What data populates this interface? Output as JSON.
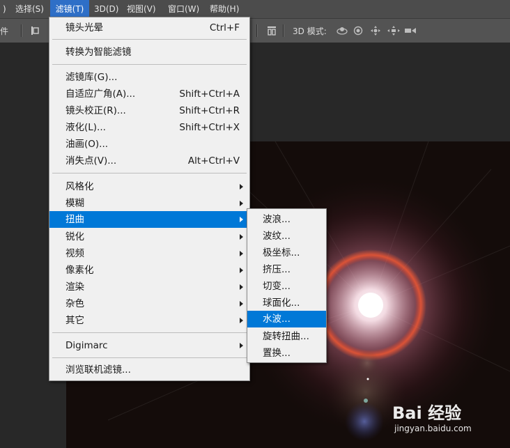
{
  "menubar": {
    "items": [
      {
        "label": ")"
      },
      {
        "label": "选择(S)"
      },
      {
        "label": "滤镜(T)"
      },
      {
        "label": "3D(D)"
      },
      {
        "label": "视图(V)"
      },
      {
        "label": "窗口(W)"
      },
      {
        "label": "帮助(H)"
      }
    ],
    "active_index": 2,
    "active_color": "#2e6fc7"
  },
  "options_bar": {
    "left_text": "件",
    "mode_label": "3D 模式:",
    "icons": [
      "align-icon",
      "distribute-icon",
      "orbit-3d-icon",
      "roll-3d-icon",
      "pan-3d-icon",
      "slide-3d-icon",
      "scale-3d-icon"
    ]
  },
  "filter_menu": {
    "items": [
      {
        "label": "镜头光晕",
        "shortcut": "Ctrl+F",
        "submenu": false
      },
      {
        "separator": true
      },
      {
        "label": "转换为智能滤镜",
        "shortcut": "",
        "submenu": false
      },
      {
        "separator": true
      },
      {
        "label": "滤镜库(G)...",
        "shortcut": "",
        "submenu": false
      },
      {
        "label": "自适应广角(A)...",
        "shortcut": "Shift+Ctrl+A",
        "submenu": false
      },
      {
        "label": "镜头校正(R)...",
        "shortcut": "Shift+Ctrl+R",
        "submenu": false
      },
      {
        "label": "液化(L)...",
        "shortcut": "Shift+Ctrl+X",
        "submenu": false
      },
      {
        "label": "油画(O)...",
        "shortcut": "",
        "submenu": false
      },
      {
        "label": "消失点(V)...",
        "shortcut": "Alt+Ctrl+V",
        "submenu": false
      },
      {
        "separator": true
      },
      {
        "label": "风格化",
        "shortcut": "",
        "submenu": true
      },
      {
        "label": "模糊",
        "shortcut": "",
        "submenu": true
      },
      {
        "label": "扭曲",
        "shortcut": "",
        "submenu": true,
        "highlighted": true
      },
      {
        "label": "锐化",
        "shortcut": "",
        "submenu": true
      },
      {
        "label": "视频",
        "shortcut": "",
        "submenu": true
      },
      {
        "label": "像素化",
        "shortcut": "",
        "submenu": true
      },
      {
        "label": "渲染",
        "shortcut": "",
        "submenu": true
      },
      {
        "label": "杂色",
        "shortcut": "",
        "submenu": true
      },
      {
        "label": "其它",
        "shortcut": "",
        "submenu": true
      },
      {
        "separator": true
      },
      {
        "label": "Digimarc",
        "shortcut": "",
        "submenu": true
      },
      {
        "separator": true
      },
      {
        "label": "浏览联机滤镜...",
        "shortcut": "",
        "submenu": false
      }
    ]
  },
  "distort_submenu": {
    "items": [
      {
        "label": "波浪..."
      },
      {
        "label": "波纹..."
      },
      {
        "label": "极坐标..."
      },
      {
        "label": "挤压..."
      },
      {
        "label": "切变..."
      },
      {
        "label": "球面化..."
      },
      {
        "label": "水波...",
        "highlighted": true
      },
      {
        "label": "旋转扭曲..."
      },
      {
        "label": "置换..."
      }
    ]
  },
  "highlight_color": "#0078d7",
  "watermark": {
    "logo": "Bai 经验",
    "url": "jingyan.baidu.com"
  }
}
